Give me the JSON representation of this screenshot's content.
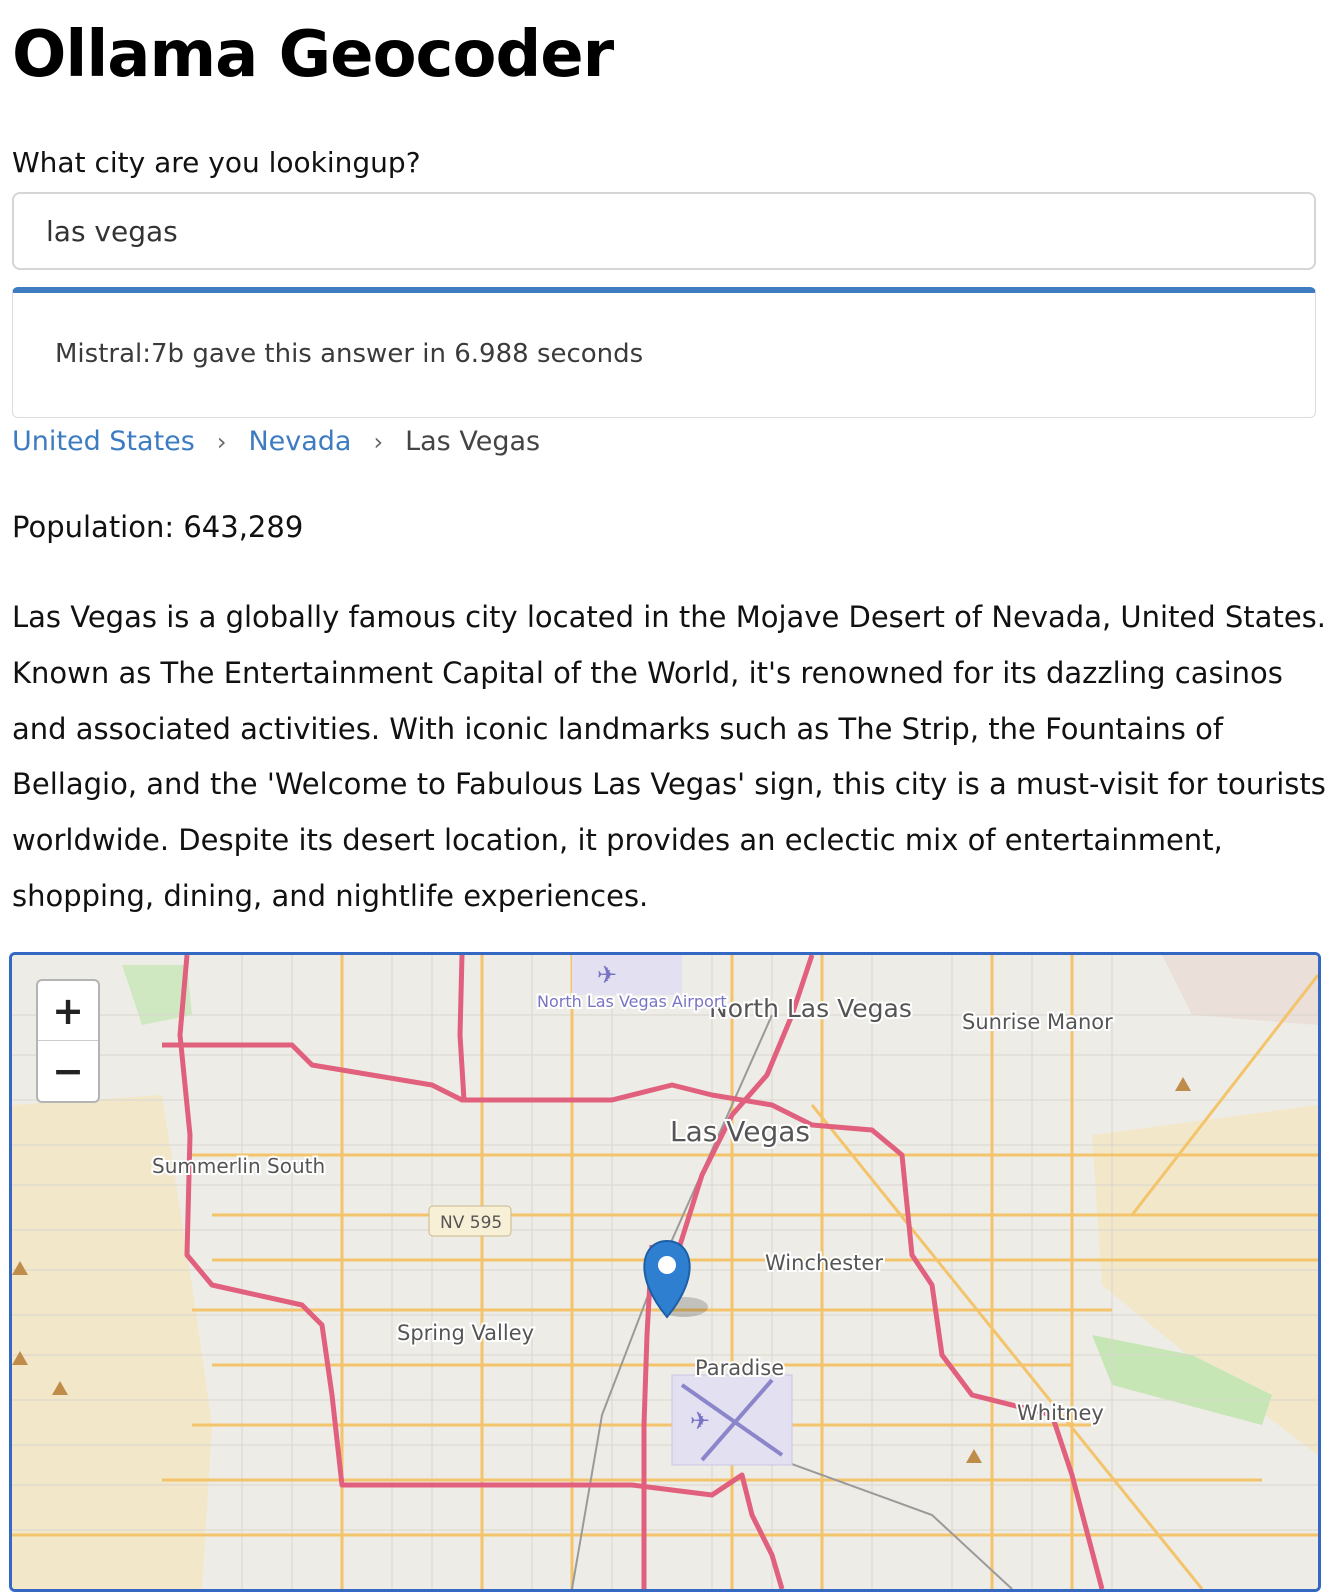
{
  "app": {
    "title": "Ollama Geocoder"
  },
  "query": {
    "label": "What city are you lookingup?",
    "value": "las vegas"
  },
  "answer": {
    "status": "Mistral:7b gave this answer in 6.988 seconds"
  },
  "breadcrumb": {
    "country": "United States",
    "region": "Nevada",
    "city": "Las Vegas",
    "separator": "›"
  },
  "result": {
    "population": "Population: 643,289",
    "description": "Las Vegas is a globally famous city located in the Mojave Desert of Nevada, United States. Known as The Entertainment Capital of the World, it's renowned for its dazzling casinos and associated activities. With iconic landmarks such as The Strip, the Fountains of Bellagio, and the 'Welcome to Fabulous Las Vegas' sign, this city is a must-visit for tourists worldwide. Despite its desert location, it provides an eclectic mix of entertainment, shopping, dining, and nightlife experiences."
  },
  "map": {
    "zoom_in": "+",
    "zoom_out": "−",
    "labels": {
      "north_las_vegas": "North Las Vegas",
      "sunrise_manor": "Sunrise Manor",
      "las_vegas": "Las Vegas",
      "summerlin_south": "Summerlin South",
      "nv595": "NV 595",
      "winchester": "Winchester",
      "spring_valley": "Spring Valley",
      "paradise": "Paradise",
      "whitney": "Whitney",
      "airport": "North Las Vegas Airport"
    },
    "colors": {
      "highway": "#e0607e",
      "major_road": "#f3c46b",
      "park": "#c6e6b5",
      "desert": "#f2e7c9",
      "marker": "#2f7fd1"
    },
    "icons": {
      "marker": "map-marker-icon",
      "airport": "airport-icon",
      "peak": "peak-icon"
    }
  }
}
